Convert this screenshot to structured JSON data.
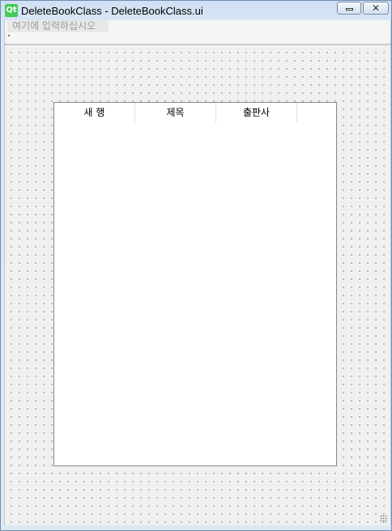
{
  "window": {
    "logo_text": "Qt",
    "title": "DeleteBookClass - DeleteBookClass.ui",
    "close_glyph": "✕"
  },
  "menubar": {
    "placeholder": "여기에 입력하십시오"
  },
  "table": {
    "headers": [
      "새 행",
      "제목",
      "출판사"
    ]
  }
}
